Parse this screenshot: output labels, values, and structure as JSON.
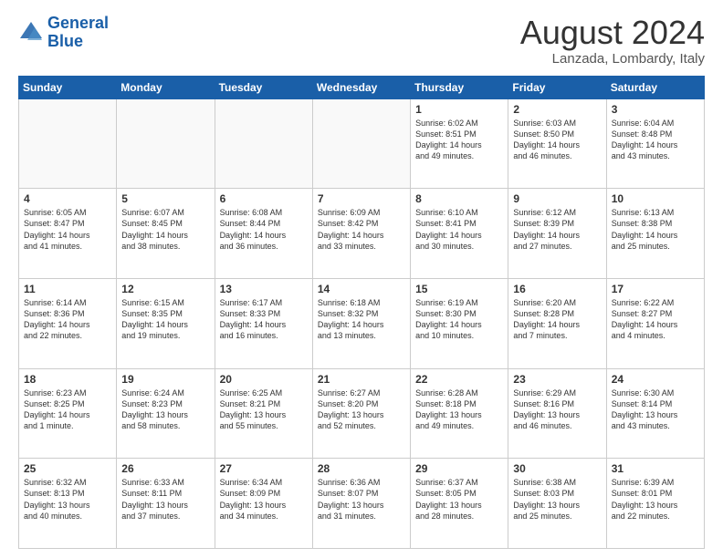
{
  "logo": {
    "line1": "General",
    "line2": "Blue"
  },
  "header": {
    "month_year": "August 2024",
    "location": "Lanzada, Lombardy, Italy"
  },
  "weekdays": [
    "Sunday",
    "Monday",
    "Tuesday",
    "Wednesday",
    "Thursday",
    "Friday",
    "Saturday"
  ],
  "weeks": [
    [
      {
        "day": "",
        "info": ""
      },
      {
        "day": "",
        "info": ""
      },
      {
        "day": "",
        "info": ""
      },
      {
        "day": "",
        "info": ""
      },
      {
        "day": "1",
        "info": "Sunrise: 6:02 AM\nSunset: 8:51 PM\nDaylight: 14 hours\nand 49 minutes."
      },
      {
        "day": "2",
        "info": "Sunrise: 6:03 AM\nSunset: 8:50 PM\nDaylight: 14 hours\nand 46 minutes."
      },
      {
        "day": "3",
        "info": "Sunrise: 6:04 AM\nSunset: 8:48 PM\nDaylight: 14 hours\nand 43 minutes."
      }
    ],
    [
      {
        "day": "4",
        "info": "Sunrise: 6:05 AM\nSunset: 8:47 PM\nDaylight: 14 hours\nand 41 minutes."
      },
      {
        "day": "5",
        "info": "Sunrise: 6:07 AM\nSunset: 8:45 PM\nDaylight: 14 hours\nand 38 minutes."
      },
      {
        "day": "6",
        "info": "Sunrise: 6:08 AM\nSunset: 8:44 PM\nDaylight: 14 hours\nand 36 minutes."
      },
      {
        "day": "7",
        "info": "Sunrise: 6:09 AM\nSunset: 8:42 PM\nDaylight: 14 hours\nand 33 minutes."
      },
      {
        "day": "8",
        "info": "Sunrise: 6:10 AM\nSunset: 8:41 PM\nDaylight: 14 hours\nand 30 minutes."
      },
      {
        "day": "9",
        "info": "Sunrise: 6:12 AM\nSunset: 8:39 PM\nDaylight: 14 hours\nand 27 minutes."
      },
      {
        "day": "10",
        "info": "Sunrise: 6:13 AM\nSunset: 8:38 PM\nDaylight: 14 hours\nand 25 minutes."
      }
    ],
    [
      {
        "day": "11",
        "info": "Sunrise: 6:14 AM\nSunset: 8:36 PM\nDaylight: 14 hours\nand 22 minutes."
      },
      {
        "day": "12",
        "info": "Sunrise: 6:15 AM\nSunset: 8:35 PM\nDaylight: 14 hours\nand 19 minutes."
      },
      {
        "day": "13",
        "info": "Sunrise: 6:17 AM\nSunset: 8:33 PM\nDaylight: 14 hours\nand 16 minutes."
      },
      {
        "day": "14",
        "info": "Sunrise: 6:18 AM\nSunset: 8:32 PM\nDaylight: 14 hours\nand 13 minutes."
      },
      {
        "day": "15",
        "info": "Sunrise: 6:19 AM\nSunset: 8:30 PM\nDaylight: 14 hours\nand 10 minutes."
      },
      {
        "day": "16",
        "info": "Sunrise: 6:20 AM\nSunset: 8:28 PM\nDaylight: 14 hours\nand 7 minutes."
      },
      {
        "day": "17",
        "info": "Sunrise: 6:22 AM\nSunset: 8:27 PM\nDaylight: 14 hours\nand 4 minutes."
      }
    ],
    [
      {
        "day": "18",
        "info": "Sunrise: 6:23 AM\nSunset: 8:25 PM\nDaylight: 14 hours\nand 1 minute."
      },
      {
        "day": "19",
        "info": "Sunrise: 6:24 AM\nSunset: 8:23 PM\nDaylight: 13 hours\nand 58 minutes."
      },
      {
        "day": "20",
        "info": "Sunrise: 6:25 AM\nSunset: 8:21 PM\nDaylight: 13 hours\nand 55 minutes."
      },
      {
        "day": "21",
        "info": "Sunrise: 6:27 AM\nSunset: 8:20 PM\nDaylight: 13 hours\nand 52 minutes."
      },
      {
        "day": "22",
        "info": "Sunrise: 6:28 AM\nSunset: 8:18 PM\nDaylight: 13 hours\nand 49 minutes."
      },
      {
        "day": "23",
        "info": "Sunrise: 6:29 AM\nSunset: 8:16 PM\nDaylight: 13 hours\nand 46 minutes."
      },
      {
        "day": "24",
        "info": "Sunrise: 6:30 AM\nSunset: 8:14 PM\nDaylight: 13 hours\nand 43 minutes."
      }
    ],
    [
      {
        "day": "25",
        "info": "Sunrise: 6:32 AM\nSunset: 8:13 PM\nDaylight: 13 hours\nand 40 minutes."
      },
      {
        "day": "26",
        "info": "Sunrise: 6:33 AM\nSunset: 8:11 PM\nDaylight: 13 hours\nand 37 minutes."
      },
      {
        "day": "27",
        "info": "Sunrise: 6:34 AM\nSunset: 8:09 PM\nDaylight: 13 hours\nand 34 minutes."
      },
      {
        "day": "28",
        "info": "Sunrise: 6:36 AM\nSunset: 8:07 PM\nDaylight: 13 hours\nand 31 minutes."
      },
      {
        "day": "29",
        "info": "Sunrise: 6:37 AM\nSunset: 8:05 PM\nDaylight: 13 hours\nand 28 minutes."
      },
      {
        "day": "30",
        "info": "Sunrise: 6:38 AM\nSunset: 8:03 PM\nDaylight: 13 hours\nand 25 minutes."
      },
      {
        "day": "31",
        "info": "Sunrise: 6:39 AM\nSunset: 8:01 PM\nDaylight: 13 hours\nand 22 minutes."
      }
    ]
  ]
}
